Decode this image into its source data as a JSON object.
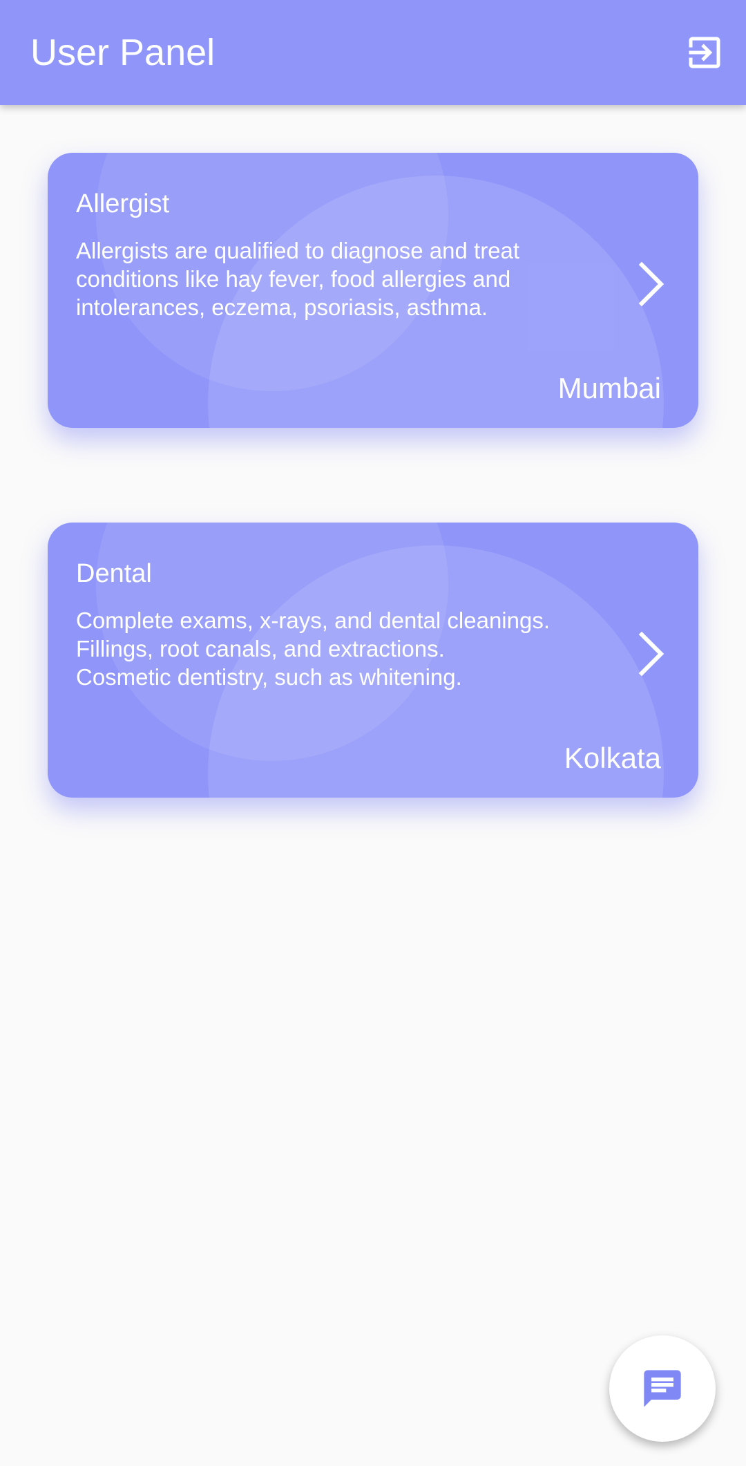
{
  "app_bar": {
    "title": "User Panel",
    "logout_icon": "exit-to-app-icon",
    "background": "#8f95f9"
  },
  "cards": [
    {
      "title": "Allergist",
      "description_lines": [
        "Allergists are qualified to diagnose and treat",
        "conditions like hay fever, food allergies and",
        "intolerances, eczema, psoriasis, asthma."
      ],
      "location": "Mumbai",
      "icon": "chevron-right-icon"
    },
    {
      "title": "Dental",
      "description_lines": [
        "Complete exams, x-rays, and dental cleanings.",
        "Fillings, root canals, and extractions.",
        "Cosmetic dentistry, such as whitening."
      ],
      "location": "Kolkata",
      "icon": "chevron-right-icon"
    }
  ],
  "fab": {
    "icon": "chat-message-icon",
    "icon_color": "#8088f5",
    "background": "#ffffff"
  },
  "colors": {
    "accent": "#8f95f9",
    "page_background": "#fafafa"
  }
}
